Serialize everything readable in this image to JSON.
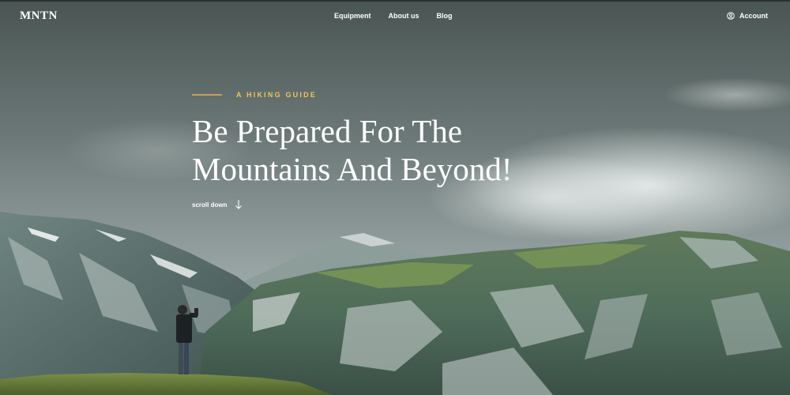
{
  "brand": {
    "logo": "MNTN"
  },
  "nav": {
    "items": [
      {
        "label": "Equipment"
      },
      {
        "label": "About us"
      },
      {
        "label": "Blog"
      }
    ],
    "account_label": "Account",
    "account_icon": "user-circle-icon"
  },
  "hero": {
    "eyebrow": "A HIKING GUIDE",
    "title_line1": "Be Prepared For The",
    "title_line2": "Mountains And Beyond!",
    "scroll_label": "scroll down",
    "scroll_icon": "arrow-down-icon"
  },
  "colors": {
    "accent": "#f0c35a",
    "text": "#ffffff"
  }
}
